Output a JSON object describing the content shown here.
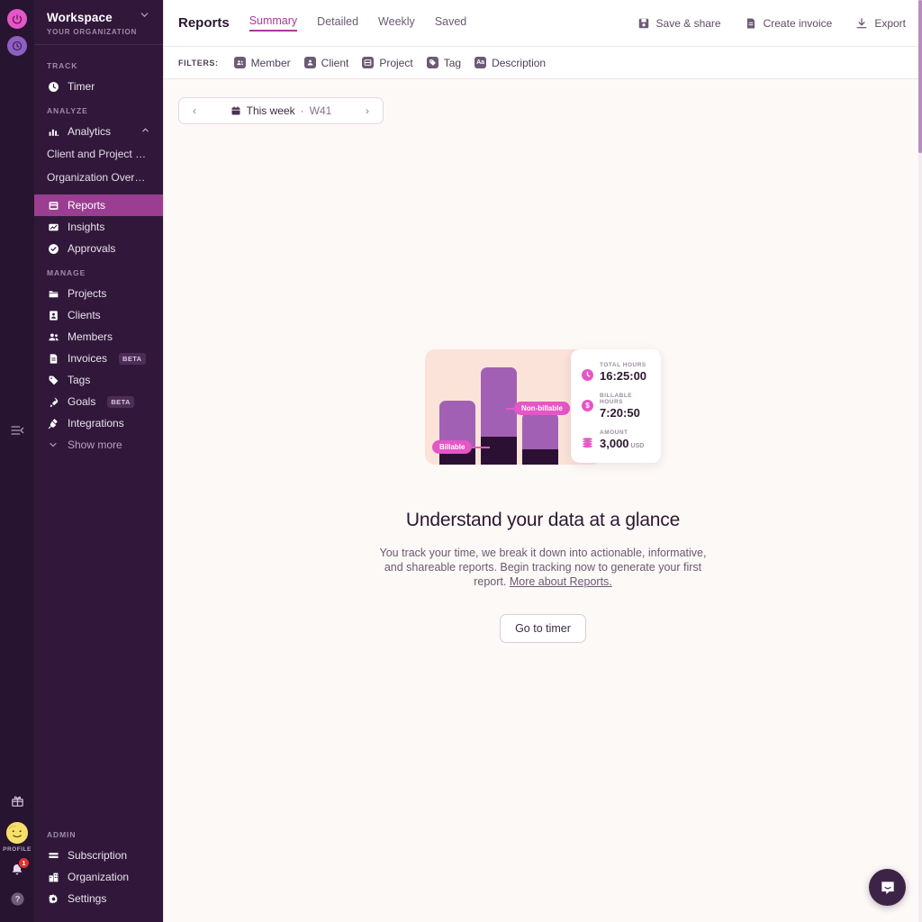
{
  "rail": {
    "power_icon": "power-icon",
    "clock_icon": "clock-icon",
    "collapse_icon": "collapse-sidebar-icon",
    "gift_icon": "gift-icon",
    "profile_label": "PROFILE",
    "notification_count": "1",
    "help_icon": "help-icon"
  },
  "sidebar": {
    "workspace_title": "Workspace",
    "workspace_subtitle": "YOUR ORGANIZATION",
    "sections": [
      {
        "label": "TRACK"
      },
      {
        "label": "ANALYZE"
      },
      {
        "label": "MANAGE"
      },
      {
        "label": "ADMIN"
      }
    ],
    "track": [
      {
        "label": "Timer",
        "icon": "clock-icon"
      }
    ],
    "analyze": {
      "parent": {
        "label": "Analytics",
        "icon": "bar-chart-icon",
        "expanded": true
      },
      "children": [
        {
          "label": "Client and Project B..."
        },
        {
          "label": "Organization Overvi..."
        }
      ],
      "items": [
        {
          "label": "Reports",
          "icon": "report-icon",
          "active": true
        },
        {
          "label": "Insights",
          "icon": "insights-icon",
          "active": false
        },
        {
          "label": "Approvals",
          "icon": "check-circle-icon",
          "active": false
        }
      ]
    },
    "manage": [
      {
        "label": "Projects",
        "icon": "folder-icon",
        "badge": ""
      },
      {
        "label": "Clients",
        "icon": "client-icon",
        "badge": ""
      },
      {
        "label": "Members",
        "icon": "members-icon",
        "badge": ""
      },
      {
        "label": "Invoices",
        "icon": "invoice-icon",
        "badge": "BETA"
      },
      {
        "label": "Tags",
        "icon": "tag-icon",
        "badge": ""
      },
      {
        "label": "Goals",
        "icon": "rocket-icon",
        "badge": "BETA"
      },
      {
        "label": "Integrations",
        "icon": "plug-icon",
        "badge": ""
      }
    ],
    "show_more": "Show more",
    "admin": [
      {
        "label": "Subscription",
        "icon": "card-icon"
      },
      {
        "label": "Organization",
        "icon": "building-icon"
      },
      {
        "label": "Settings",
        "icon": "gear-icon"
      }
    ]
  },
  "header": {
    "title": "Reports",
    "tabs": [
      {
        "label": "Summary",
        "active": true
      },
      {
        "label": "Detailed",
        "active": false
      },
      {
        "label": "Weekly",
        "active": false
      },
      {
        "label": "Saved",
        "active": false
      }
    ],
    "actions": [
      {
        "label": "Save & share",
        "icon": "save-icon"
      },
      {
        "label": "Create invoice",
        "icon": "invoice-icon"
      },
      {
        "label": "Export",
        "icon": "download-icon"
      }
    ]
  },
  "filters": {
    "label": "FILTERS:",
    "items": [
      {
        "label": "Member",
        "icon": "member-icon",
        "glyph": "▣"
      },
      {
        "label": "Client",
        "icon": "client-icon",
        "glyph": "▣"
      },
      {
        "label": "Project",
        "icon": "project-icon",
        "glyph": "▤"
      },
      {
        "label": "Tag",
        "icon": "tag-icon",
        "glyph": "◆"
      },
      {
        "label": "Description",
        "icon": "description-icon",
        "glyph": "Aa"
      }
    ]
  },
  "daterange": {
    "prev": "‹",
    "next": "›",
    "calendar_icon": "calendar-icon",
    "label": "This week",
    "separator": "·",
    "week": "W41"
  },
  "empty_state": {
    "title": "Understand your data at a glance",
    "description": "You track your time, we break it down into actionable, informative, and shareable reports. Begin tracking now to generate your first report.",
    "link_text": "More about Reports.",
    "button_label": "Go to timer",
    "illustration": {
      "tag_billable": "Billable",
      "tag_nonbillable": "Non-billable",
      "stats": [
        {
          "label": "TOTAL HOURS",
          "value": "16:25:00",
          "unit": "",
          "icon": "clock-icon"
        },
        {
          "label": "BILLABLE HOURS",
          "value": "7:20:50",
          "unit": "",
          "icon": "dollar-icon"
        },
        {
          "label": "AMOUNT",
          "value": "3,000",
          "unit": "USD",
          "icon": "coins-icon"
        }
      ]
    }
  },
  "chat": {
    "icon": "chat-bubble-icon"
  },
  "colors": {
    "accent": "#a83a9b",
    "sidebar_bg": "#31183a",
    "rail_bg": "#271430",
    "active_item": "#9b3d90",
    "pink": "#e556c6",
    "purple_bar": "#a260b4",
    "dark_bar": "#2b1034",
    "illo_bg": "#fbe3d9",
    "page_bg": "#fdf9f7"
  }
}
